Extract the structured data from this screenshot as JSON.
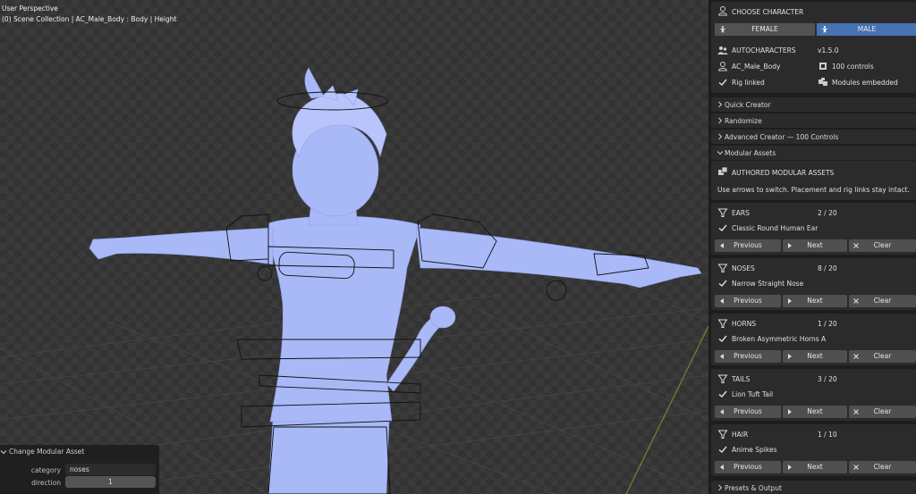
{
  "viewport": {
    "perspective_label": "User Perspective",
    "collection_label": "(0) Scene Collection | AC_Male_Body : Body | Height"
  },
  "operator_panel": {
    "title": "Change Modular Asset",
    "fields": [
      {
        "label": "category",
        "value": "noses"
      },
      {
        "label": "direction",
        "value": "1"
      }
    ]
  },
  "character": {
    "choose_label": "CHOOSE CHARACTER",
    "options": [
      "FEMALE",
      "MALE"
    ],
    "selected": "MALE",
    "addon_name": "AUTOCHARACTERS",
    "version": "v1.5.0",
    "body_name": "AC_Male_Body",
    "controls": "100 controls",
    "rig_status": "Rig linked",
    "modules_status": "Modules embedded"
  },
  "collapsed_sections": [
    {
      "label": "Quick Creator",
      "expanded": false
    },
    {
      "label": "Randomize",
      "expanded": false
    },
    {
      "label": "Advanced Creator — 100 Controls",
      "expanded": false
    }
  ],
  "modular": {
    "section_label": "Modular Assets",
    "expanded": true,
    "header": "AUTHORED MODULAR ASSETS",
    "hint": "Use arrows to switch. Placement and rig links stay intact.",
    "nav": {
      "previous": "Previous",
      "next": "Next",
      "clear": "Clear"
    },
    "categories": [
      {
        "name": "EARS",
        "count": "2 / 20",
        "asset": "Classic Round Human Ear"
      },
      {
        "name": "NOSES",
        "count": "8 / 20",
        "asset": "Narrow Straight Nose"
      },
      {
        "name": "HORNS",
        "count": "1 / 20",
        "asset": "Broken Asymmetric Horns A"
      },
      {
        "name": "TAILS",
        "count": "3 / 20",
        "asset": "Lion Tuft Tail"
      },
      {
        "name": "HAIR",
        "count": "1 / 10",
        "asset": "Anime Spikes"
      }
    ]
  },
  "footer_section": {
    "label": "Presets & Output",
    "expanded": false
  },
  "colors": {
    "accent": "#4772b3",
    "body": "#a9b8f7",
    "panel_bg": "#1d1d1d"
  }
}
